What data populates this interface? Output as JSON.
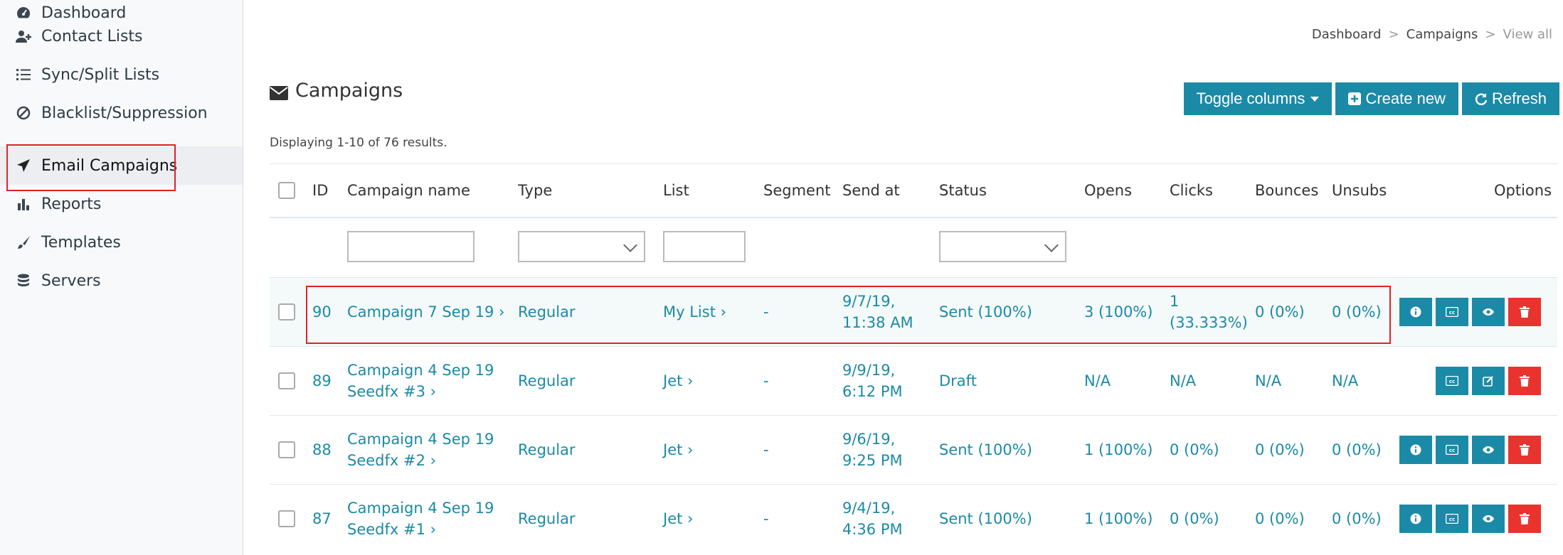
{
  "sidebar": {
    "items": [
      {
        "label": "Dashboard",
        "icon": "dashboard-icon"
      },
      {
        "label": "Contact Lists",
        "icon": "user-plus-icon"
      },
      {
        "label": "Sync/Split Lists",
        "icon": "list-icon"
      },
      {
        "label": "Blacklist/Suppression",
        "icon": "ban-icon"
      },
      {
        "label": "Email Campaigns",
        "icon": "paper-plane-icon"
      },
      {
        "label": "Reports",
        "icon": "bar-chart-icon"
      },
      {
        "label": "Templates",
        "icon": "paint-brush-icon"
      },
      {
        "label": "Servers",
        "icon": "database-icon"
      }
    ]
  },
  "breadcrumb": {
    "items": [
      "Dashboard",
      "Campaigns",
      "View all"
    ]
  },
  "page": {
    "title": "Campaigns",
    "summary": "Displaying 1-10 of 76 results."
  },
  "toolbar": {
    "toggle_label": "Toggle columns",
    "create_label": "Create new",
    "refresh_label": "Refresh"
  },
  "table": {
    "headers": [
      "ID",
      "Campaign name",
      "Type",
      "List",
      "Segment",
      "Send at",
      "Status",
      "Opens",
      "Clicks",
      "Bounces",
      "Unsubs",
      "Options"
    ],
    "rows": [
      {
        "id": "90",
        "name1": "Campaign 7 Sep 19 ›",
        "name2": "",
        "type": "Regular",
        "list": "My List ›",
        "segment": "-",
        "send1": "9/7/19,",
        "send2": "11:38 AM",
        "status": "Sent (100%)",
        "opens": "3 (100%)",
        "clicks1": "1",
        "clicks2": "(33.333%)",
        "bounces": "0 (0%)",
        "unsubs": "0 (0%)",
        "options": [
          "info",
          "stats",
          "view",
          "delete"
        ]
      },
      {
        "id": "89",
        "name1": "Campaign 4 Sep 19",
        "name2": "Seedfx #3 ›",
        "type": "Regular",
        "list": "Jet ›",
        "segment": "-",
        "send1": "9/9/19,",
        "send2": "6:12 PM",
        "status": "Draft",
        "opens": "N/A",
        "clicks1": "N/A",
        "clicks2": "",
        "bounces": "N/A",
        "unsubs": "N/A",
        "options": [
          "stats",
          "edit",
          "delete"
        ]
      },
      {
        "id": "88",
        "name1": "Campaign 4 Sep 19",
        "name2": "Seedfx #2 ›",
        "type": "Regular",
        "list": "Jet ›",
        "segment": "-",
        "send1": "9/6/19,",
        "send2": "9:25 PM",
        "status": "Sent (100%)",
        "opens": "1 (100%)",
        "clicks1": "0 (0%)",
        "clicks2": "",
        "bounces": "0 (0%)",
        "unsubs": "0 (0%)",
        "options": [
          "info",
          "stats",
          "view",
          "delete"
        ]
      },
      {
        "id": "87",
        "name1": "Campaign 4 Sep 19",
        "name2": "Seedfx #1 ›",
        "type": "Regular",
        "list": "Jet ›",
        "segment": "-",
        "send1": "9/4/19,",
        "send2": "4:36 PM",
        "status": "Sent (100%)",
        "opens": "1 (100%)",
        "clicks1": "0 (0%)",
        "clicks2": "",
        "bounces": "0 (0%)",
        "unsubs": "0 (0%)",
        "options": [
          "info",
          "stats",
          "view",
          "delete"
        ]
      }
    ]
  },
  "colors": {
    "accent": "#1b8aa6",
    "danger": "#e8332e",
    "highlight": "#e0222a"
  }
}
